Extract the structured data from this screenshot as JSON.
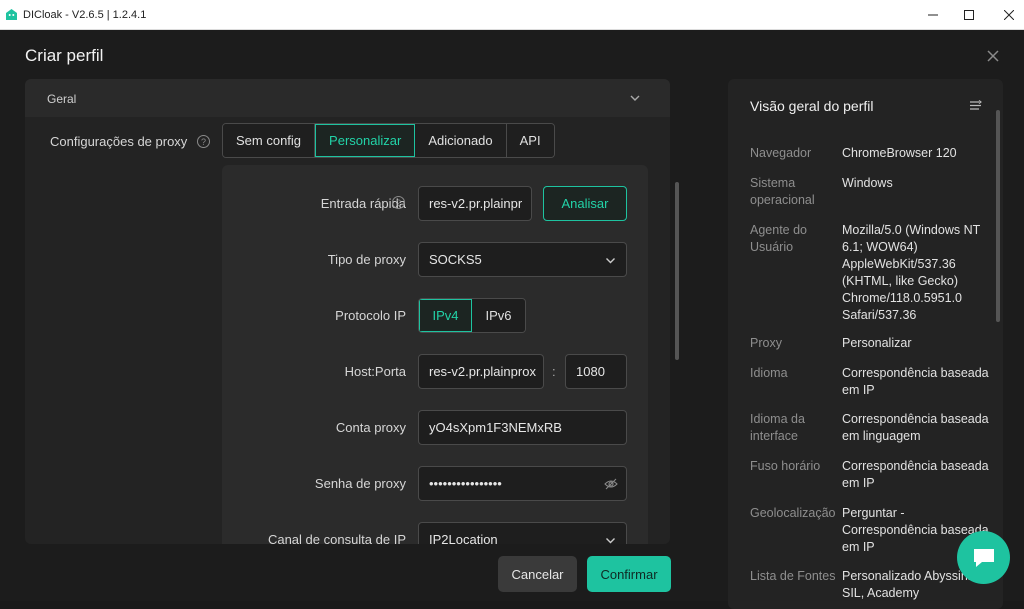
{
  "window": {
    "title": "DICloak - V2.6.5 | 1.2.4.1",
    "controls": [
      "minimize",
      "maximize",
      "close"
    ]
  },
  "dialog": {
    "title": "Criar perfil",
    "section": "Geral",
    "proxy_settings_label": "Configurações de proxy",
    "proxy_tabs": [
      {
        "label": "Sem config",
        "active": false
      },
      {
        "label": "Personalizar",
        "active": true
      },
      {
        "label": "Adicionado",
        "active": false
      },
      {
        "label": "API",
        "active": false
      }
    ],
    "form": {
      "quick_entry": {
        "label": "Entrada rápida",
        "value": "res-v2.pr.plainpr",
        "button": "Analisar"
      },
      "proxy_type": {
        "label": "Tipo de proxy",
        "value": "SOCKS5"
      },
      "ip_protocol": {
        "label": "Protocolo IP",
        "options": [
          "IPv4",
          "IPv6"
        ],
        "selected": "IPv4"
      },
      "host_port": {
        "label": "Host:Porta",
        "host": "res-v2.pr.plainprox",
        "separator": ":",
        "port": "1080"
      },
      "account": {
        "label": "Conta proxy",
        "value": "yO4sXpm1F3NEMxRB"
      },
      "password": {
        "label": "Senha de proxy",
        "value": "••••••••••••••••"
      },
      "ip_channel": {
        "label": "Canal de consulta de IP",
        "value": "IP2Location"
      }
    },
    "buttons": {
      "cancel": "Cancelar",
      "confirm": "Confirmar"
    }
  },
  "overview": {
    "title": "Visão geral do perfil",
    "rows": [
      {
        "key": "Navegador",
        "value": "ChromeBrowser 120"
      },
      {
        "key": "Sistema operacional",
        "value": "Windows"
      },
      {
        "key": "Agente do Usuário",
        "value": "Mozilla/5.0 (Windows NT 6.1; WOW64) AppleWebKit/537.36 (KHTML, like Gecko) Chrome/118.0.5951.0 Safari/537.36"
      },
      {
        "key": "Proxy",
        "value": "Personalizar"
      },
      {
        "key": "Idioma",
        "value": "Correspondência baseada em IP"
      },
      {
        "key": "Idioma da interface",
        "value": "Correspondência baseada em linguagem"
      },
      {
        "key": "Fuso horário",
        "value": "Correspondência baseada em IP"
      },
      {
        "key": "Geolocalização",
        "value": "Perguntar - Correspondência baseada em IP"
      },
      {
        "key": "Lista de Fontes",
        "value": "Personalizado Abyssinica SIL, Academy"
      }
    ]
  },
  "colors": {
    "accent": "#1ec3a0",
    "background": "#1c1c1c",
    "panel": "#232323"
  }
}
